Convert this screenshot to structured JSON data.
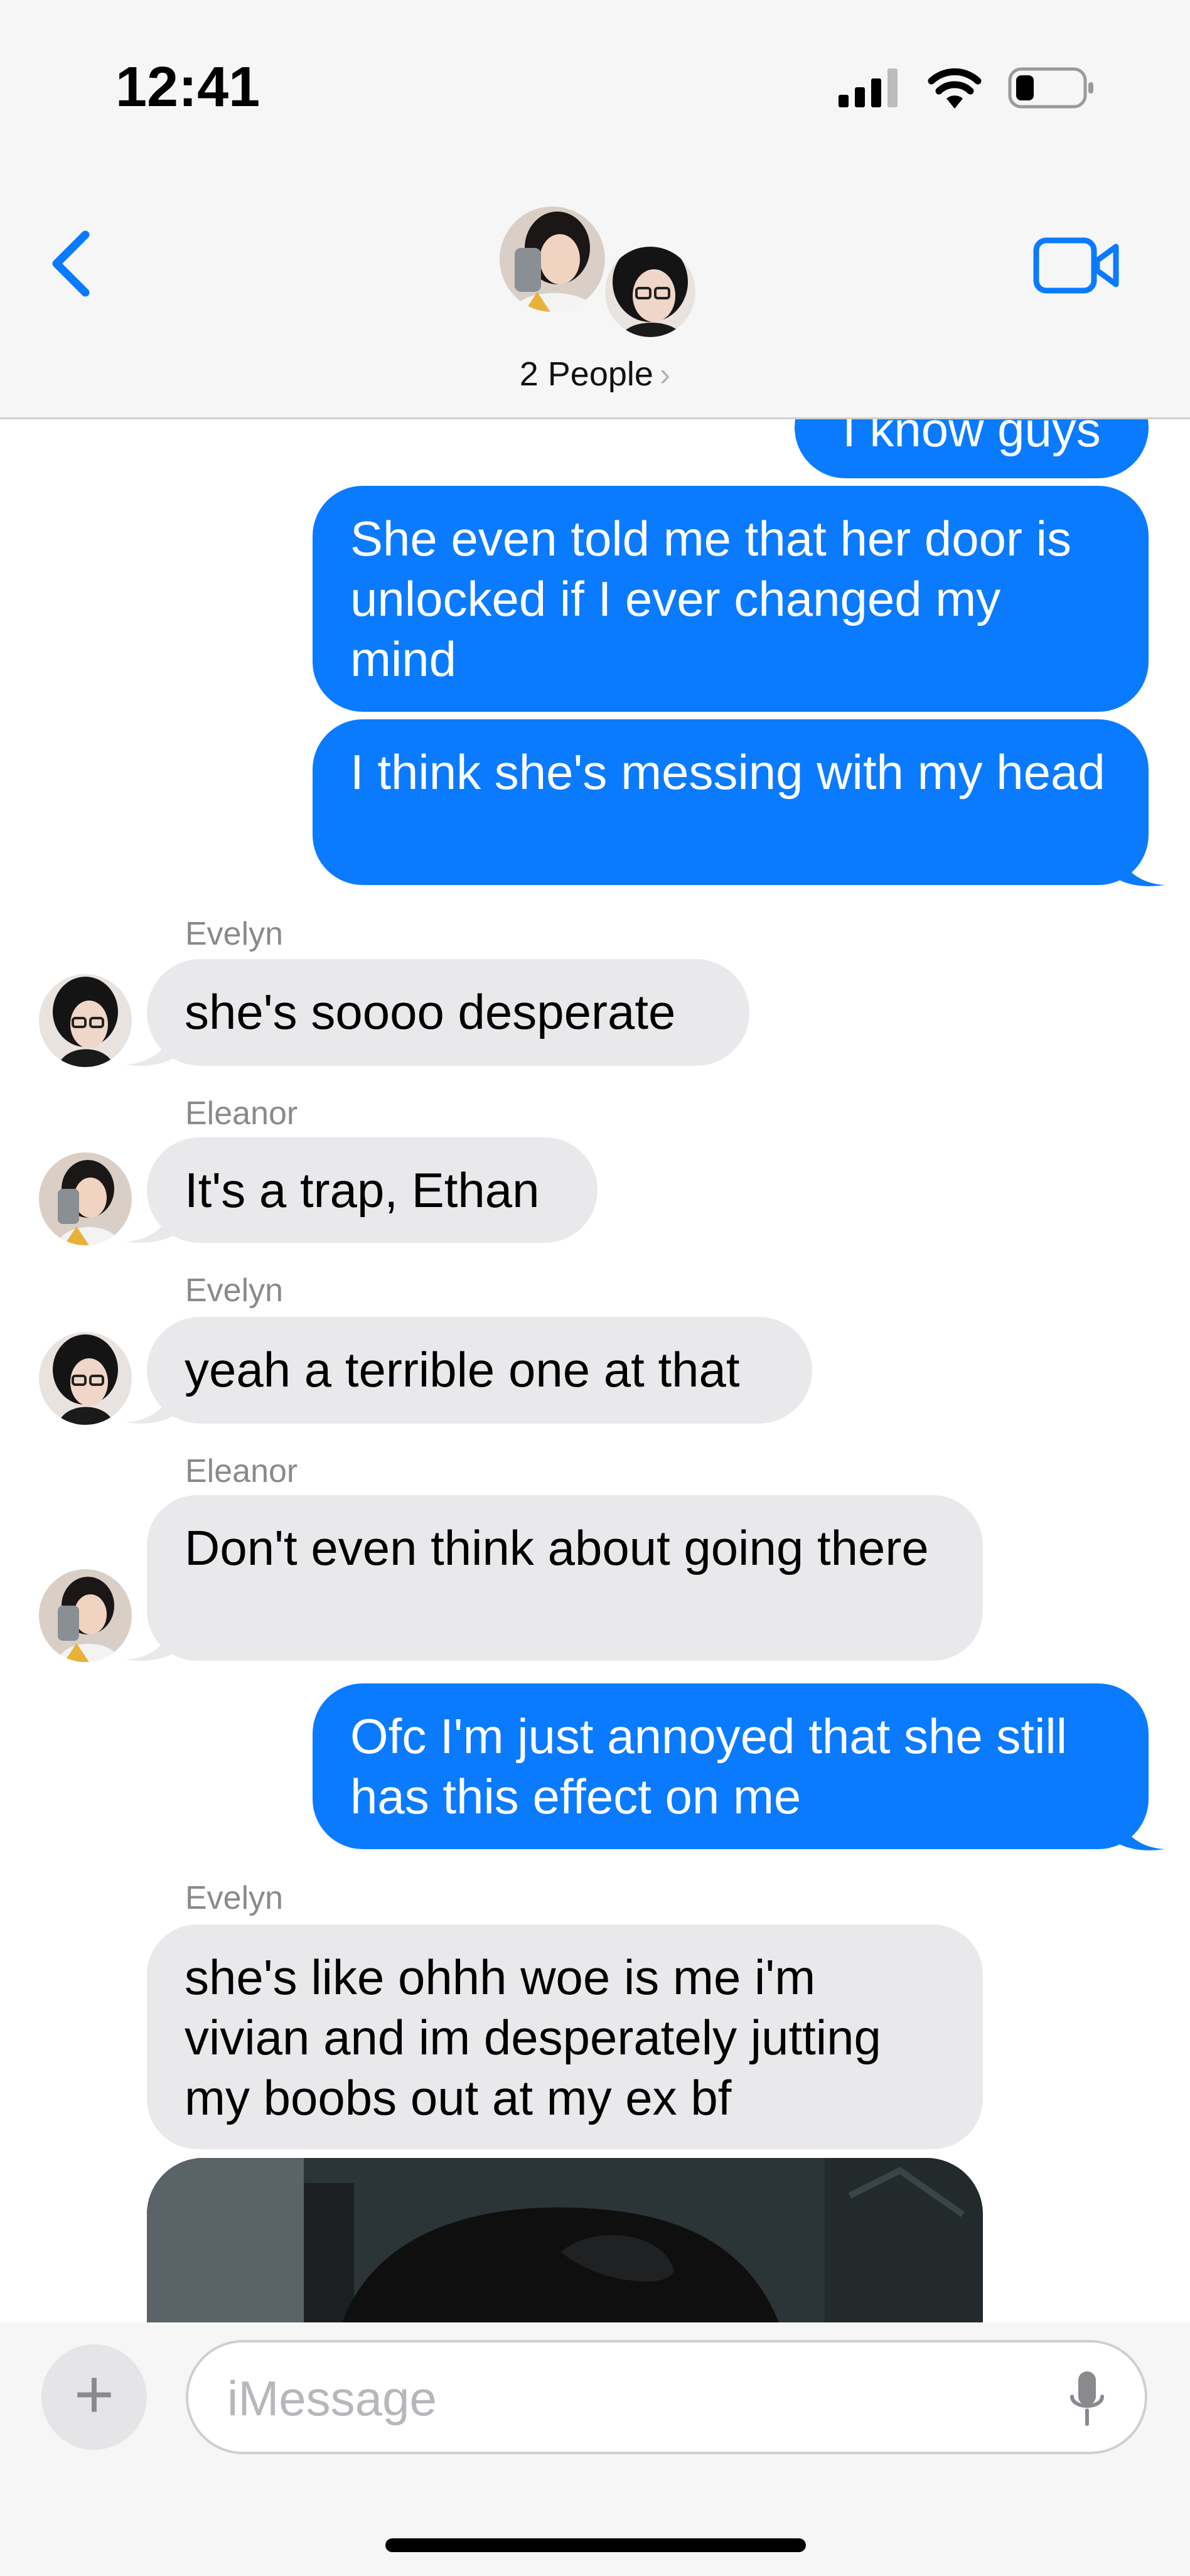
{
  "status_bar": {
    "time": "12:41"
  },
  "header": {
    "people_label": "2 People",
    "chevron": "›"
  },
  "messages": [
    {
      "type": "outgoing",
      "text": "I know guys"
    },
    {
      "type": "outgoing",
      "text": "She even told me that her door is unlocked if I ever changed my mind"
    },
    {
      "type": "outgoing",
      "text": "I think she's messing with my head"
    },
    {
      "type": "incoming",
      "sender": "Evelyn",
      "text": "she's soooo desperate"
    },
    {
      "type": "incoming",
      "sender": "Eleanor",
      "text": "It's a trap, Ethan"
    },
    {
      "type": "incoming",
      "sender": "Evelyn",
      "text": "yeah a terrible one at that"
    },
    {
      "type": "incoming",
      "sender": "Eleanor",
      "text": "Don't even think about going there"
    },
    {
      "type": "outgoing",
      "text": "Ofc I'm just annoyed that she still has this effect on me"
    },
    {
      "type": "incoming",
      "sender": "Evelyn",
      "text": "she's like ohhh woe is me i'm vivian and im desperately jutting my boobs out at my ex bf"
    }
  ],
  "composer": {
    "placeholder": "iMessage",
    "plus": "+"
  },
  "colors": {
    "outgoing_bubble": "#0a7bff",
    "incoming_bubble": "#e9e9eb",
    "accent": "#0a7bff",
    "sender_label": "#8a8a8e"
  },
  "icons": [
    "back-chevron-icon",
    "video-camera-icon",
    "signal-icon",
    "wifi-icon",
    "battery-icon",
    "plus-icon",
    "microphone-icon"
  ]
}
